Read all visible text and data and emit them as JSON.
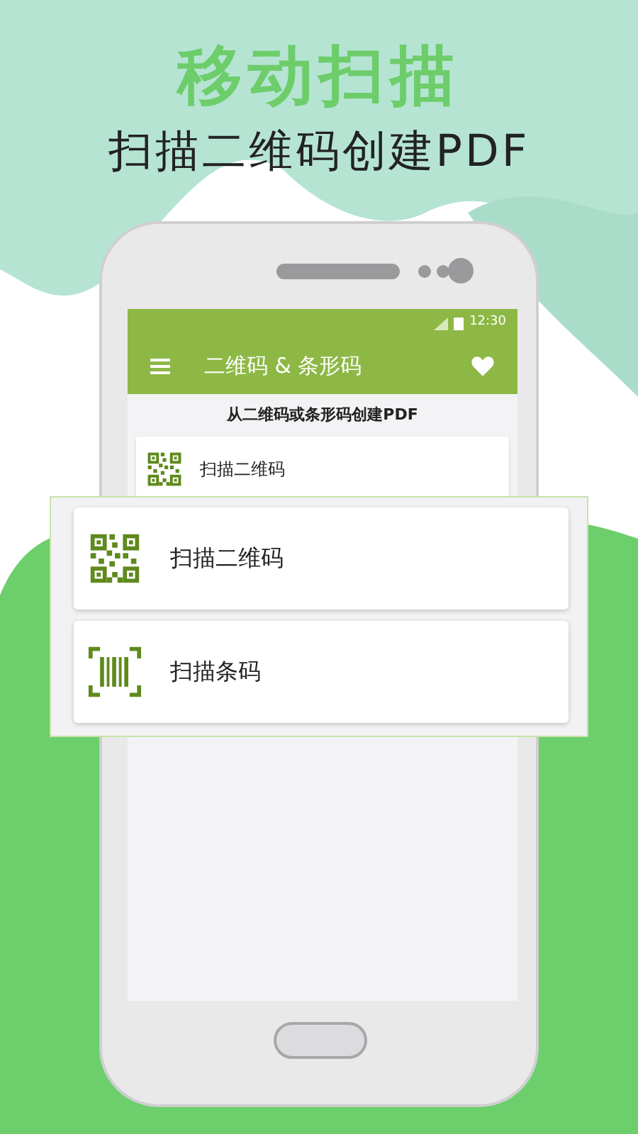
{
  "headline": "移动扫描",
  "subtitle": "扫描二维码创建PDF",
  "status_bar": {
    "time": "12:30"
  },
  "app_bar": {
    "title": "二维码 & 条形码"
  },
  "screen_heading": "从二维码或条形码创建PDF",
  "screen_items": [
    {
      "kind": "qr",
      "label": "扫描二维码"
    }
  ],
  "popup_items": [
    {
      "kind": "qr",
      "label": "扫描二维码"
    },
    {
      "kind": "barcode",
      "label": "扫描条码"
    }
  ]
}
